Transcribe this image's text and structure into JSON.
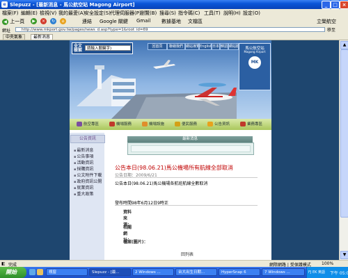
{
  "window": {
    "title": "Slepuzz - [最新消息 - 馬公航空站 Magong Airport]",
    "minimize": "_",
    "maximize": "□",
    "close": "×"
  },
  "menu": [
    "檔案(F)",
    "編輯(E)",
    "檢視(V)",
    "我的最愛(A)",
    "安全設定(S)",
    "代理伺服器(P)",
    "瀏覽(B)",
    "搜尋(S)",
    "指令碼(C)",
    "工具(T)",
    "說明(H)",
    "設定(O)"
  ],
  "toolbar": {
    "back": "上一頁",
    "address_label": "網址",
    "items": [
      "連結",
      "Google 關鍵",
      "Gmail",
      "數據基地",
      "文檔區"
    ],
    "right_item": "立榮航空"
  },
  "address": {
    "label": "網址",
    "url": "http://www.mkport.gov.tw/pages/news_d.asp?type=1&root_id=69",
    "go": "移至"
  },
  "tabs": [
    "中央氣象",
    "最新消息"
  ],
  "site": {
    "search_label": "全文檢索",
    "search_placeholder": "請輸入關鍵字)",
    "top_links": [
      "回首頁",
      "聯絡我們",
      "網站導覽",
      "English",
      "日本語",
      "韓語",
      "網站服務",
      "民眾意見"
    ],
    "logo_title": "馬公航空站",
    "logo_sub": "Magong Airport",
    "logo_mark": "MK",
    "nav": [
      "航空專區",
      "機場服務",
      "機場設施",
      "便民服務",
      "公告資訊",
      "業務專區"
    ],
    "left_menu_title": "公告資訊",
    "left_menu": [
      "最新消息",
      "公告事項",
      "活動資訊",
      "採購資訊",
      "公文附件下載",
      "政府資訊公開",
      "就業資訊",
      "重大政策"
    ],
    "news_bar": "最新消息",
    "headline": "公告本日(98.06.21)馬公機場所有航線全部取消",
    "pubdate": "公告日期：2009/6/21",
    "body": "公告本日(98.06.21)馬公機場各航班航線全數取消",
    "release": "發布時間98年6月12日9時正",
    "field_source": "資料來源：",
    "field_links": "相關網址：",
    "field_files": "檔案(圖片)：",
    "back": "回列表"
  },
  "status": {
    "text": "完成",
    "zone": "網際網路",
    "protected": "受保護模式",
    "zoom": "100%"
  },
  "taskbar": {
    "start": "開始",
    "tasks": [
      "視窗",
      "Slepuzz - [最...",
      "2 Windows ...",
      "台大出生日期...",
      "HyperSnap 6",
      "7 Windows ..."
    ],
    "clock": "下午 05:06",
    "tray_label": "FJ EK 英語"
  },
  "colors": {
    "title_bar": "#0a55d8",
    "page_bg": "#1e466f",
    "headline": "#c00000",
    "nav_bar": "#a9c75c"
  }
}
